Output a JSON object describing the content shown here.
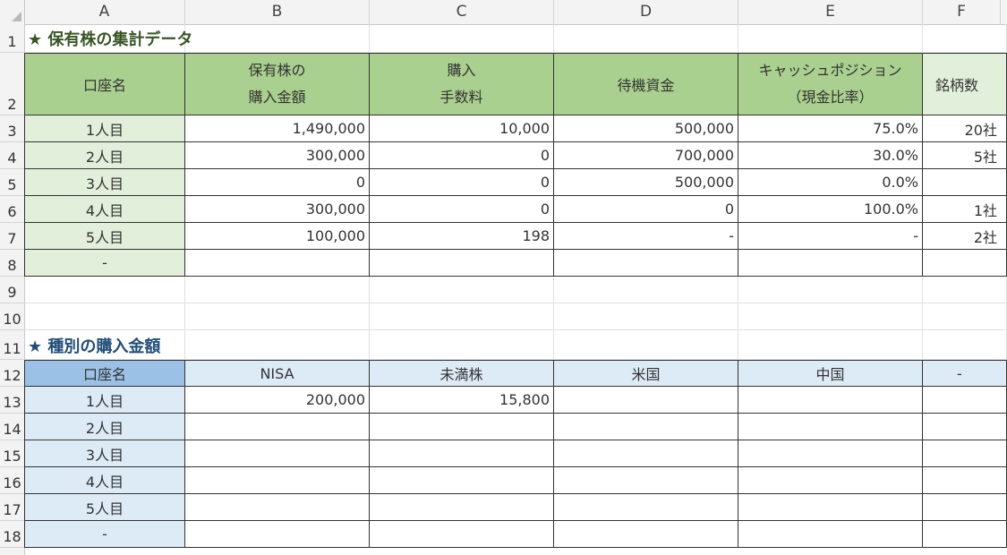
{
  "columns": [
    "A",
    "B",
    "C",
    "D",
    "E",
    "F"
  ],
  "rows": [
    "1",
    "2",
    "3",
    "4",
    "5",
    "6",
    "7",
    "8",
    "9",
    "10",
    "11",
    "12",
    "13",
    "14",
    "15",
    "16",
    "17",
    "18"
  ],
  "section1": {
    "title": "★ 保有株の集計データ",
    "headers": {
      "account": "口座名",
      "purchase_line1": "保有株の",
      "purchase_line2": "購入金額",
      "fee_line1": "購入",
      "fee_line2": "手数料",
      "cash": "待機資金",
      "position_line1": "キャッシュポジション",
      "position_line2": "（現金比率）",
      "stocks": "銘柄数"
    },
    "rows": [
      {
        "account": "1人目",
        "purchase": "1,490,000",
        "fee": "10,000",
        "cash": "500,000",
        "ratio": "75.0%",
        "stocks": "20社"
      },
      {
        "account": "2人目",
        "purchase": "300,000",
        "fee": "0",
        "cash": "700,000",
        "ratio": "30.0%",
        "stocks": "5社"
      },
      {
        "account": "3人目",
        "purchase": "0",
        "fee": "0",
        "cash": "500,000",
        "ratio": "0.0%",
        "stocks": ""
      },
      {
        "account": "4人目",
        "purchase": "300,000",
        "fee": "0",
        "cash": "0",
        "ratio": "100.0%",
        "stocks": "1社"
      },
      {
        "account": "5人目",
        "purchase": "100,000",
        "fee": "198",
        "cash": "-",
        "ratio": "-",
        "stocks": "2社"
      },
      {
        "account": "-",
        "purchase": "",
        "fee": "",
        "cash": "",
        "ratio": "",
        "stocks": ""
      }
    ]
  },
  "section2": {
    "title": "★ 種別の購入金額",
    "headers": {
      "account": "口座名",
      "nisa": "NISA",
      "odd_lot": "未満株",
      "us": "米国",
      "china": "中国",
      "other": "-"
    },
    "rows": [
      {
        "account": "1人目",
        "nisa": "200,000",
        "odd_lot": "15,800",
        "us": "",
        "china": "",
        "other": ""
      },
      {
        "account": "2人目",
        "nisa": "",
        "odd_lot": "",
        "us": "",
        "china": "",
        "other": ""
      },
      {
        "account": "3人目",
        "nisa": "",
        "odd_lot": "",
        "us": "",
        "china": "",
        "other": ""
      },
      {
        "account": "4人目",
        "nisa": "",
        "odd_lot": "",
        "us": "",
        "china": "",
        "other": ""
      },
      {
        "account": "5人目",
        "nisa": "",
        "odd_lot": "",
        "us": "",
        "china": "",
        "other": ""
      },
      {
        "account": "-",
        "nisa": "",
        "odd_lot": "",
        "us": "",
        "china": "",
        "other": ""
      }
    ]
  }
}
